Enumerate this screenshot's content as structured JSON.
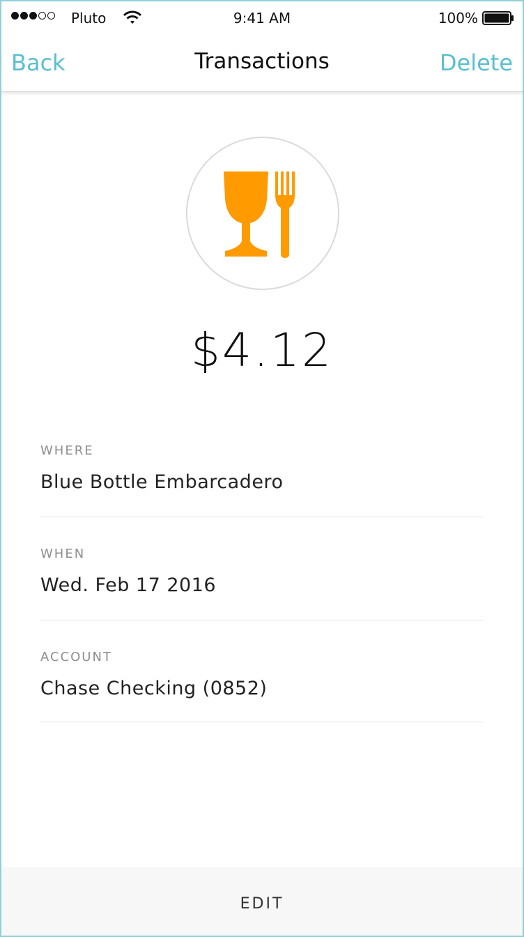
{
  "status_bar": {
    "carrier": "Pluto",
    "time": "9:41 AM",
    "battery": "100%",
    "signal_strength": 3,
    "signal_total": 5
  },
  "nav": {
    "back_label": "Back",
    "title": "Transactions",
    "delete_label": "Delete"
  },
  "accent_color": "#5bbfcf",
  "category": {
    "icon": "food-drink-icon",
    "color": "#ff9a00"
  },
  "transaction": {
    "amount": "$4.12",
    "fields": [
      {
        "label": "WHERE",
        "value": "Blue Bottle Embarcadero"
      },
      {
        "label": "WHEN",
        "value": "Wed. Feb 17 2016"
      },
      {
        "label": "ACCOUNT",
        "value": "Chase Checking (0852)"
      }
    ]
  },
  "footer": {
    "edit_label": "EDIT"
  }
}
